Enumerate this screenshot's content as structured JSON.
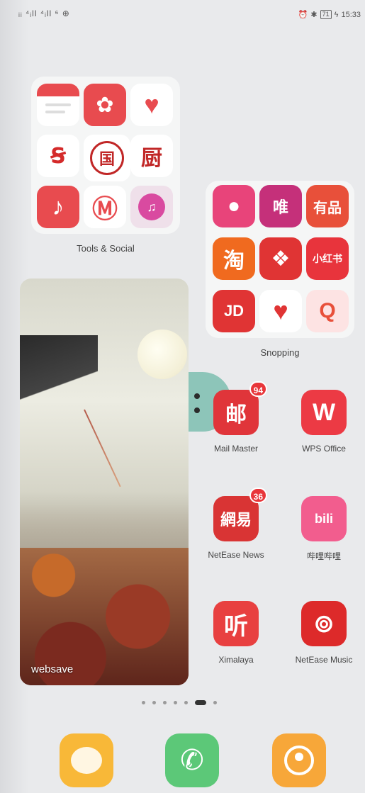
{
  "status_bar": {
    "left_text": "ᵢᵢ ⁴ᵢll ⁴ᵢll ⁶ ⊕",
    "battery": "71",
    "time": "15:33"
  },
  "folders": {
    "tools": {
      "label": "Tools & Social",
      "apps": [
        {
          "name": "notes",
          "glyph": "≡",
          "color": "#e84b4f"
        },
        {
          "name": "lotus",
          "glyph": "✿",
          "color": "#e84b4f"
        },
        {
          "name": "heart",
          "glyph": "♥",
          "color": "#e84b4f"
        },
        {
          "name": "bank-a",
          "glyph": "Ꞩ",
          "color": "#ffffff"
        },
        {
          "name": "bank-b",
          "glyph": "国",
          "color": "#ffffff"
        },
        {
          "name": "kitchen",
          "glyph": "厨",
          "color": "#ffffff"
        },
        {
          "name": "music-note",
          "glyph": "♪",
          "color": "#e84b4f"
        },
        {
          "name": "metro",
          "glyph": "Ⓜ",
          "color": "#e84b4f"
        },
        {
          "name": "music-box",
          "glyph": "♫",
          "color": "#d94aa0"
        }
      ]
    },
    "shopping": {
      "label": "Snopping",
      "apps": [
        {
          "name": "mushroom",
          "glyph": "●",
          "color": "#e8447a"
        },
        {
          "name": "vip",
          "glyph": "唯",
          "color": "#c5307a"
        },
        {
          "name": "youpin",
          "glyph": "有品",
          "color": "#e8503a"
        },
        {
          "name": "taobao",
          "glyph": "淘",
          "color": "#f06a1f"
        },
        {
          "name": "pattern",
          "glyph": "❖",
          "color": "#e03434"
        },
        {
          "name": "xiaohongshu",
          "glyph": "小红书",
          "color": "#e8343c"
        },
        {
          "name": "jd",
          "glyph": "JD",
          "color": "#e03434"
        },
        {
          "name": "pinduoduo",
          "glyph": "♥",
          "color": "#e03434"
        },
        {
          "name": "pdd-q",
          "glyph": "Q",
          "color": "#e8503a"
        }
      ]
    }
  },
  "widget": {
    "label": "websave"
  },
  "apps": [
    {
      "label": "Mail Master",
      "glyph": "邮",
      "color": "#e0353a",
      "badge": "94"
    },
    {
      "label": "WPS Office",
      "glyph": "W",
      "color": "#ec3a44",
      "badge": ""
    },
    {
      "label": "NetEase News",
      "glyph": "網易",
      "color": "#d93434",
      "badge": "36"
    },
    {
      "label": "哔哩哔哩",
      "glyph": "bili",
      "color": "#f25d8e",
      "badge": ""
    },
    {
      "label": "Ximalaya",
      "glyph": "听",
      "color": "#e84040",
      "badge": ""
    },
    {
      "label": "NetEase Music",
      "glyph": "⊚",
      "color": "#dd2a2a",
      "badge": ""
    }
  ],
  "page_indicator": {
    "count": 7,
    "active": 5
  },
  "dock": [
    {
      "name": "messages",
      "color": "#f8b838"
    },
    {
      "name": "phone",
      "color": "#5cc878"
    },
    {
      "name": "contacts",
      "color": "#f7a739"
    }
  ]
}
